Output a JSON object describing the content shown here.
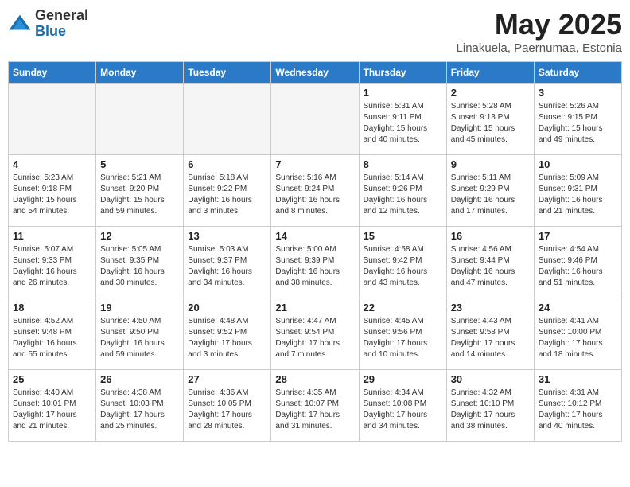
{
  "header": {
    "logo_general": "General",
    "logo_blue": "Blue",
    "month_title": "May 2025",
    "location": "Linakuela, Paernumaa, Estonia"
  },
  "days_of_week": [
    "Sunday",
    "Monday",
    "Tuesday",
    "Wednesday",
    "Thursday",
    "Friday",
    "Saturday"
  ],
  "weeks": [
    [
      {
        "day": "",
        "info": ""
      },
      {
        "day": "",
        "info": ""
      },
      {
        "day": "",
        "info": ""
      },
      {
        "day": "",
        "info": ""
      },
      {
        "day": "1",
        "info": "Sunrise: 5:31 AM\nSunset: 9:11 PM\nDaylight: 15 hours\nand 40 minutes."
      },
      {
        "day": "2",
        "info": "Sunrise: 5:28 AM\nSunset: 9:13 PM\nDaylight: 15 hours\nand 45 minutes."
      },
      {
        "day": "3",
        "info": "Sunrise: 5:26 AM\nSunset: 9:15 PM\nDaylight: 15 hours\nand 49 minutes."
      }
    ],
    [
      {
        "day": "4",
        "info": "Sunrise: 5:23 AM\nSunset: 9:18 PM\nDaylight: 15 hours\nand 54 minutes."
      },
      {
        "day": "5",
        "info": "Sunrise: 5:21 AM\nSunset: 9:20 PM\nDaylight: 15 hours\nand 59 minutes."
      },
      {
        "day": "6",
        "info": "Sunrise: 5:18 AM\nSunset: 9:22 PM\nDaylight: 16 hours\nand 3 minutes."
      },
      {
        "day": "7",
        "info": "Sunrise: 5:16 AM\nSunset: 9:24 PM\nDaylight: 16 hours\nand 8 minutes."
      },
      {
        "day": "8",
        "info": "Sunrise: 5:14 AM\nSunset: 9:26 PM\nDaylight: 16 hours\nand 12 minutes."
      },
      {
        "day": "9",
        "info": "Sunrise: 5:11 AM\nSunset: 9:29 PM\nDaylight: 16 hours\nand 17 minutes."
      },
      {
        "day": "10",
        "info": "Sunrise: 5:09 AM\nSunset: 9:31 PM\nDaylight: 16 hours\nand 21 minutes."
      }
    ],
    [
      {
        "day": "11",
        "info": "Sunrise: 5:07 AM\nSunset: 9:33 PM\nDaylight: 16 hours\nand 26 minutes."
      },
      {
        "day": "12",
        "info": "Sunrise: 5:05 AM\nSunset: 9:35 PM\nDaylight: 16 hours\nand 30 minutes."
      },
      {
        "day": "13",
        "info": "Sunrise: 5:03 AM\nSunset: 9:37 PM\nDaylight: 16 hours\nand 34 minutes."
      },
      {
        "day": "14",
        "info": "Sunrise: 5:00 AM\nSunset: 9:39 PM\nDaylight: 16 hours\nand 38 minutes."
      },
      {
        "day": "15",
        "info": "Sunrise: 4:58 AM\nSunset: 9:42 PM\nDaylight: 16 hours\nand 43 minutes."
      },
      {
        "day": "16",
        "info": "Sunrise: 4:56 AM\nSunset: 9:44 PM\nDaylight: 16 hours\nand 47 minutes."
      },
      {
        "day": "17",
        "info": "Sunrise: 4:54 AM\nSunset: 9:46 PM\nDaylight: 16 hours\nand 51 minutes."
      }
    ],
    [
      {
        "day": "18",
        "info": "Sunrise: 4:52 AM\nSunset: 9:48 PM\nDaylight: 16 hours\nand 55 minutes."
      },
      {
        "day": "19",
        "info": "Sunrise: 4:50 AM\nSunset: 9:50 PM\nDaylight: 16 hours\nand 59 minutes."
      },
      {
        "day": "20",
        "info": "Sunrise: 4:48 AM\nSunset: 9:52 PM\nDaylight: 17 hours\nand 3 minutes."
      },
      {
        "day": "21",
        "info": "Sunrise: 4:47 AM\nSunset: 9:54 PM\nDaylight: 17 hours\nand 7 minutes."
      },
      {
        "day": "22",
        "info": "Sunrise: 4:45 AM\nSunset: 9:56 PM\nDaylight: 17 hours\nand 10 minutes."
      },
      {
        "day": "23",
        "info": "Sunrise: 4:43 AM\nSunset: 9:58 PM\nDaylight: 17 hours\nand 14 minutes."
      },
      {
        "day": "24",
        "info": "Sunrise: 4:41 AM\nSunset: 10:00 PM\nDaylight: 17 hours\nand 18 minutes."
      }
    ],
    [
      {
        "day": "25",
        "info": "Sunrise: 4:40 AM\nSunset: 10:01 PM\nDaylight: 17 hours\nand 21 minutes."
      },
      {
        "day": "26",
        "info": "Sunrise: 4:38 AM\nSunset: 10:03 PM\nDaylight: 17 hours\nand 25 minutes."
      },
      {
        "day": "27",
        "info": "Sunrise: 4:36 AM\nSunset: 10:05 PM\nDaylight: 17 hours\nand 28 minutes."
      },
      {
        "day": "28",
        "info": "Sunrise: 4:35 AM\nSunset: 10:07 PM\nDaylight: 17 hours\nand 31 minutes."
      },
      {
        "day": "29",
        "info": "Sunrise: 4:34 AM\nSunset: 10:08 PM\nDaylight: 17 hours\nand 34 minutes."
      },
      {
        "day": "30",
        "info": "Sunrise: 4:32 AM\nSunset: 10:10 PM\nDaylight: 17 hours\nand 38 minutes."
      },
      {
        "day": "31",
        "info": "Sunrise: 4:31 AM\nSunset: 10:12 PM\nDaylight: 17 hours\nand 40 minutes."
      }
    ]
  ]
}
